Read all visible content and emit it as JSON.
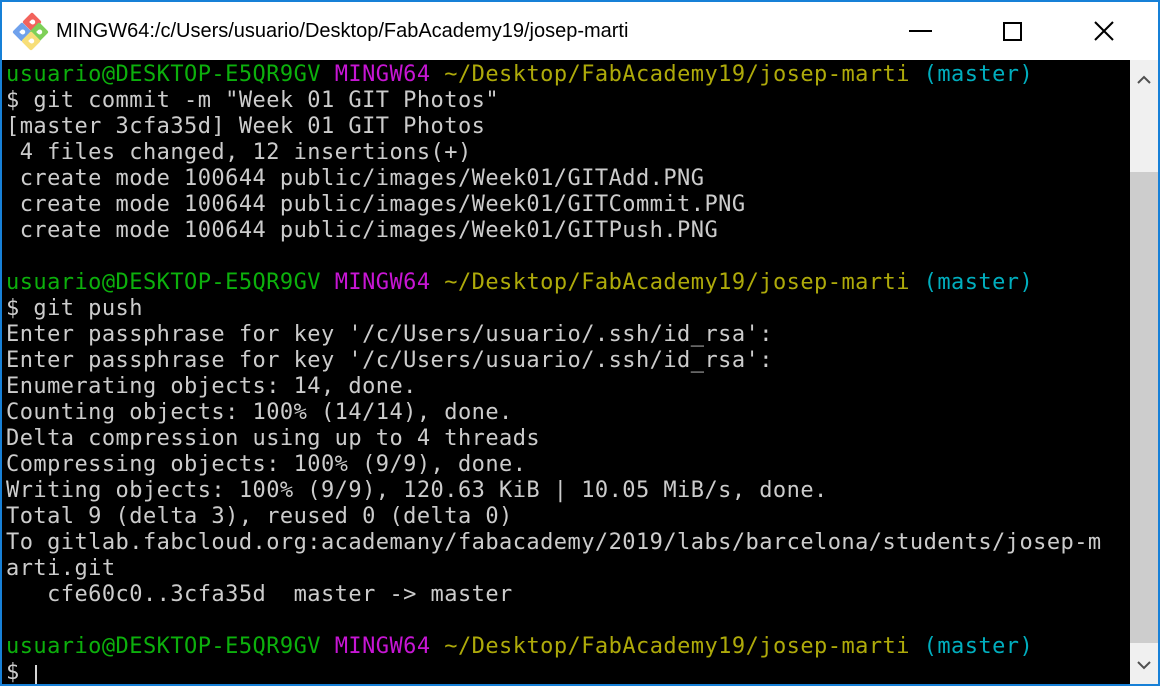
{
  "window": {
    "title": "MINGW64:/c/Users/usuario/Desktop/FabAcademy19/josep-marti",
    "icon_colors": {
      "red": "#F2635C",
      "blue": "#6FA1EC",
      "green": "#7ED058",
      "yellow": "#F7DE78"
    },
    "controls": {
      "minimize": "minimize",
      "maximize": "maximize",
      "close": "close"
    }
  },
  "colors": {
    "window_border": "#1780D7",
    "titlebar_bg": "#FFFFFF",
    "titlebar_text": "#000000",
    "terminal_bg": "#000000",
    "fg": "#CCCCCC",
    "green": "#0CB00C",
    "magenta": "#C716D4",
    "yellow": "#AEAA0A",
    "cyan": "#00AEBE",
    "scrollbar_track": "#F0F0F0",
    "scrollbar_thumb": "#CDCDCD",
    "scrollbar_arrow": "#505050"
  },
  "terminal": {
    "lines": [
      {
        "segments": [
          {
            "text": "usuario@DESKTOP-E5QR9GV",
            "color": "green"
          },
          {
            "text": " ",
            "color": "fg"
          },
          {
            "text": "MINGW64",
            "color": "magenta"
          },
          {
            "text": " ",
            "color": "fg"
          },
          {
            "text": "~/Desktop/FabAcademy19/josep-marti",
            "color": "yellow"
          },
          {
            "text": " ",
            "color": "fg"
          },
          {
            "text": "(master)",
            "color": "cyan"
          }
        ]
      },
      {
        "segments": [
          {
            "text": "$ git commit -m \"Week 01 GIT Photos\"",
            "color": "fg"
          }
        ]
      },
      {
        "segments": [
          {
            "text": "[master 3cfa35d] Week 01 GIT Photos",
            "color": "fg"
          }
        ]
      },
      {
        "segments": [
          {
            "text": " 4 files changed, 12 insertions(+)",
            "color": "fg"
          }
        ]
      },
      {
        "segments": [
          {
            "text": " create mode 100644 public/images/Week01/GITAdd.PNG",
            "color": "fg"
          }
        ]
      },
      {
        "segments": [
          {
            "text": " create mode 100644 public/images/Week01/GITCommit.PNG",
            "color": "fg"
          }
        ]
      },
      {
        "segments": [
          {
            "text": " create mode 100644 public/images/Week01/GITPush.PNG",
            "color": "fg"
          }
        ]
      },
      {
        "segments": []
      },
      {
        "segments": [
          {
            "text": "usuario@DESKTOP-E5QR9GV",
            "color": "green"
          },
          {
            "text": " ",
            "color": "fg"
          },
          {
            "text": "MINGW64",
            "color": "magenta"
          },
          {
            "text": " ",
            "color": "fg"
          },
          {
            "text": "~/Desktop/FabAcademy19/josep-marti",
            "color": "yellow"
          },
          {
            "text": " ",
            "color": "fg"
          },
          {
            "text": "(master)",
            "color": "cyan"
          }
        ]
      },
      {
        "segments": [
          {
            "text": "$ git push",
            "color": "fg"
          }
        ]
      },
      {
        "segments": [
          {
            "text": "Enter passphrase for key '/c/Users/usuario/.ssh/id_rsa':",
            "color": "fg"
          }
        ]
      },
      {
        "segments": [
          {
            "text": "Enter passphrase for key '/c/Users/usuario/.ssh/id_rsa':",
            "color": "fg"
          }
        ]
      },
      {
        "segments": [
          {
            "text": "Enumerating objects: 14, done.",
            "color": "fg"
          }
        ]
      },
      {
        "segments": [
          {
            "text": "Counting objects: 100% (14/14), done.",
            "color": "fg"
          }
        ]
      },
      {
        "segments": [
          {
            "text": "Delta compression using up to 4 threads",
            "color": "fg"
          }
        ]
      },
      {
        "segments": [
          {
            "text": "Compressing objects: 100% (9/9), done.",
            "color": "fg"
          }
        ]
      },
      {
        "segments": [
          {
            "text": "Writing objects: 100% (9/9), 120.63 KiB | 10.05 MiB/s, done.",
            "color": "fg"
          }
        ]
      },
      {
        "segments": [
          {
            "text": "Total 9 (delta 3), reused 0 (delta 0)",
            "color": "fg"
          }
        ]
      },
      {
        "segments": [
          {
            "text": "To gitlab.fabcloud.org:academany/fabacademy/2019/labs/barcelona/students/josep-m",
            "color": "fg"
          }
        ]
      },
      {
        "segments": [
          {
            "text": "arti.git",
            "color": "fg"
          }
        ]
      },
      {
        "segments": [
          {
            "text": "   cfe60c0..3cfa35d  master -> master",
            "color": "fg"
          }
        ]
      },
      {
        "segments": []
      },
      {
        "segments": [
          {
            "text": "usuario@DESKTOP-E5QR9GV",
            "color": "green"
          },
          {
            "text": " ",
            "color": "fg"
          },
          {
            "text": "MINGW64",
            "color": "magenta"
          },
          {
            "text": " ",
            "color": "fg"
          },
          {
            "text": "~/Desktop/FabAcademy19/josep-marti",
            "color": "yellow"
          },
          {
            "text": " ",
            "color": "fg"
          },
          {
            "text": "(master)",
            "color": "cyan"
          }
        ]
      },
      {
        "segments": [
          {
            "text": "$ ",
            "color": "fg"
          }
        ],
        "cursor": true
      }
    ]
  },
  "scrollbar": {
    "up_icon": "chevron-up-icon",
    "down_icon": "chevron-down-icon"
  }
}
